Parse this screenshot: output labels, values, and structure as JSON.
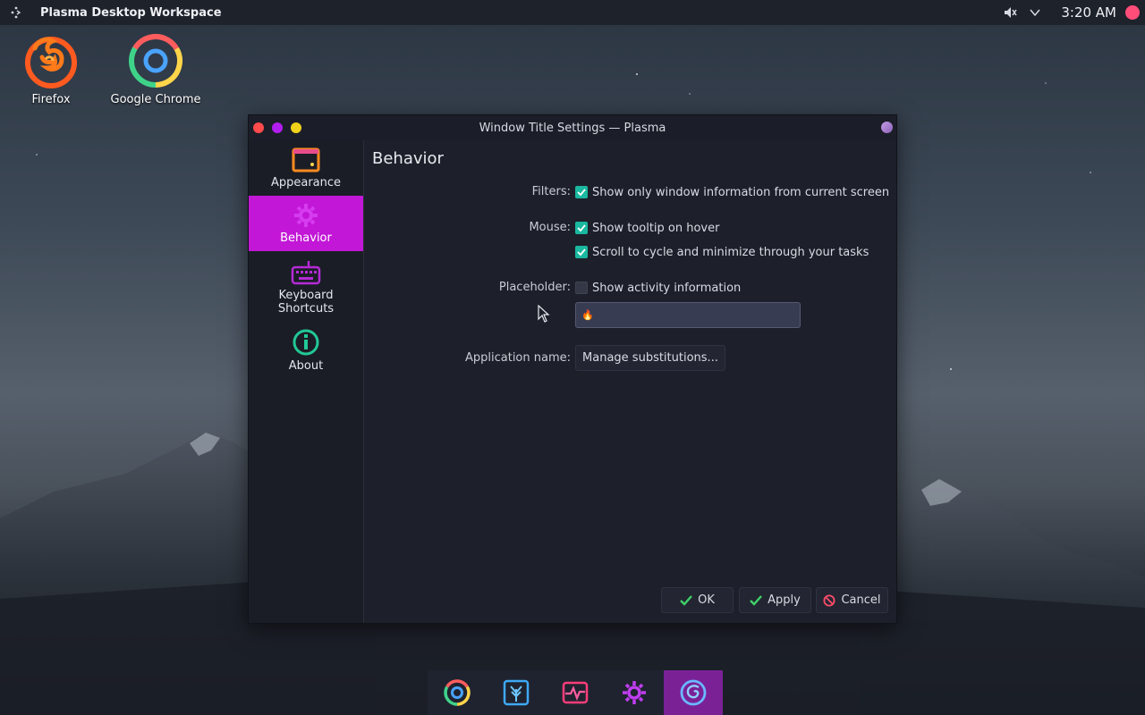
{
  "panel": {
    "title": "Plasma Desktop Workspace",
    "clock": "3:20 AM",
    "icons": [
      "launcher-icon",
      "speaker-muted-icon",
      "chevron-down-icon",
      "user-avatar-icon"
    ]
  },
  "desktop": {
    "icons": [
      {
        "label": "Firefox",
        "icon": "firefox-icon"
      },
      {
        "label": "Google Chrome",
        "icon": "chrome-icon"
      }
    ]
  },
  "window": {
    "title": "Window Title Settings — Plasma",
    "sidebar": [
      {
        "label": "Appearance",
        "icon": "appearance-icon",
        "active": false
      },
      {
        "label": "Behavior",
        "icon": "behavior-gear-icon",
        "active": true
      },
      {
        "label": "Keyboard Shortcuts",
        "line1": "Keyboard",
        "line2": "Shortcuts",
        "icon": "keyboard-icon",
        "active": false
      },
      {
        "label": "About",
        "icon": "info-icon",
        "active": false
      }
    ],
    "page": {
      "title": "Behavior",
      "filters_label": "Filters:",
      "filters_option": "Show only window information from current screen",
      "filters_checked": true,
      "mouse_label": "Mouse:",
      "mouse_option1": "Show tooltip on hover",
      "mouse_option1_checked": true,
      "mouse_option2": "Scroll to cycle and minimize through your tasks",
      "mouse_option2_checked": true,
      "placeholder_label": "Placeholder:",
      "placeholder_option": "Show activity information",
      "placeholder_checked": false,
      "placeholder_value": "🔥",
      "appname_label": "Application name:",
      "appname_button": "Manage substitutions..."
    },
    "buttons": {
      "ok": "OK",
      "apply": "Apply",
      "cancel": "Cancel"
    }
  },
  "dock": {
    "items": [
      "chrome-icon",
      "tree-app-icon",
      "system-monitor-icon",
      "settings-gear-icon",
      "plasma-app-icon"
    ],
    "active_index": 4
  },
  "colors": {
    "accent": "#c217d6",
    "checkbox": "#1ab8a0",
    "dock_active": "#7a2196"
  }
}
